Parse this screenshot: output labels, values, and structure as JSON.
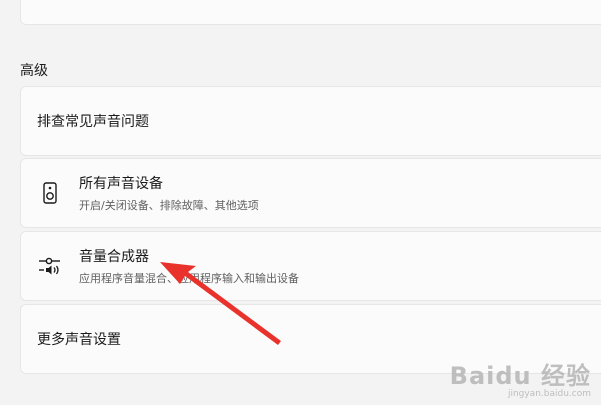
{
  "section": {
    "title": "高级"
  },
  "rows": [
    {
      "title": "排查常见声音问题"
    },
    {
      "title": "所有声音设备",
      "subtitle": "开启/关闭设备、排除故障、其他选项",
      "icon": "speaker-device-icon"
    },
    {
      "title": "音量合成器",
      "subtitle": "应用程序音量混合、应用程序输入和输出设备",
      "icon": "volume-mixer-icon"
    },
    {
      "title": "更多声音设置"
    }
  ],
  "watermark": {
    "brand": "Baidu 经验",
    "url": "jingyan.baidu.com"
  },
  "colors": {
    "arrow": "#e8322b",
    "card": "#fbfbfb",
    "background": "#f3f3f3"
  }
}
